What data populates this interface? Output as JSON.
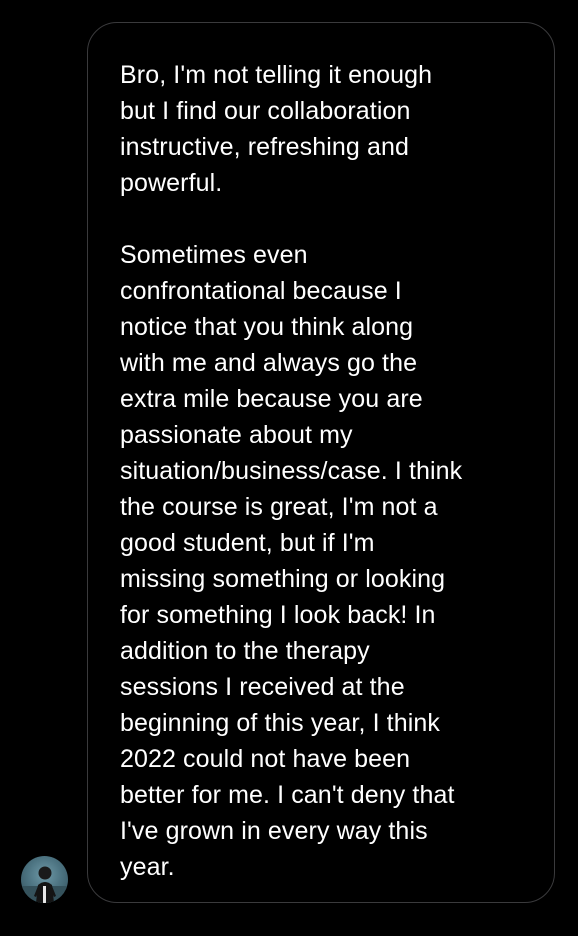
{
  "message": {
    "paragraph_1": [
      "Bro, I'm not telling it enough",
      "but I find our collaboration",
      "instructive, refreshing and",
      "powerful."
    ],
    "paragraph_2": [
      "Sometimes even",
      "confrontational because I",
      "notice that you think along",
      "with me and always go the",
      "extra mile because you are",
      "passionate about my",
      "situation/business/case. I think",
      "the course is great, I'm not a",
      "good student, but if I'm",
      "missing something or looking",
      "for something I look back! In",
      "addition to the therapy",
      "sessions I received at the",
      "beginning of this year, I think",
      "2022 could not have been",
      "better for me. I can't deny that",
      "I've grown in every way this",
      "year."
    ]
  },
  "avatar": {
    "icon": "user-avatar-photo"
  },
  "colors": {
    "background": "#000000",
    "bubble_border": "#3a3a3c",
    "text": "#ffffff"
  }
}
